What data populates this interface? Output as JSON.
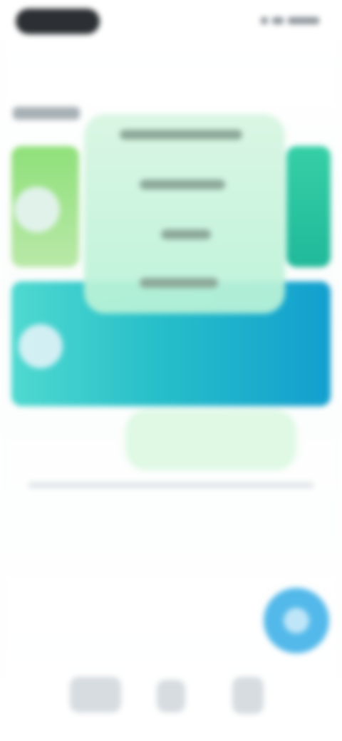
{
  "colors": {
    "status_pill": "#2c2f33",
    "card_left": "#8fe07a",
    "card_right": "#20b99a",
    "card_bottom_start": "#4fd9d0",
    "card_bottom_end": "#129fcf",
    "popup_menu": "#c7f3dc",
    "fab": "#53b9ea"
  },
  "icons": {
    "status_left": "status-pill-icon",
    "signal": "signal-icon",
    "wifi": "wifi-icon",
    "battery": "battery-icon",
    "card_left": "circle-icon",
    "card_bottom": "circle-icon",
    "fab": "circle-icon",
    "nav_home": "home-icon",
    "nav_mid": "tab-icon",
    "nav_profile": "profile-icon"
  },
  "section": {
    "title": ""
  },
  "menu": {
    "items": [
      "",
      "",
      "",
      ""
    ]
  }
}
